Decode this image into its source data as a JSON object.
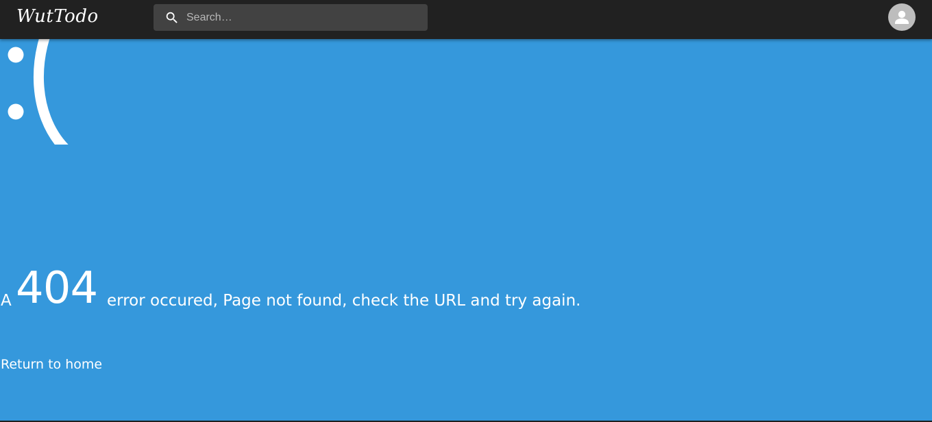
{
  "header": {
    "logo": "WutTodo",
    "search": {
      "placeholder": "Search…",
      "icon": "search-icon"
    },
    "avatar_icon": "account-icon"
  },
  "error": {
    "face": ":(",
    "prefix": "A",
    "code": "404",
    "suffix": "error occured, Page not found, check the URL and try again."
  },
  "home_link": "Return to home",
  "colors": {
    "background": "#3598dc",
    "appbar": "#212121",
    "search_bg": "#424242",
    "avatar_bg": "#bdbdbd",
    "text": "#ffffff"
  }
}
